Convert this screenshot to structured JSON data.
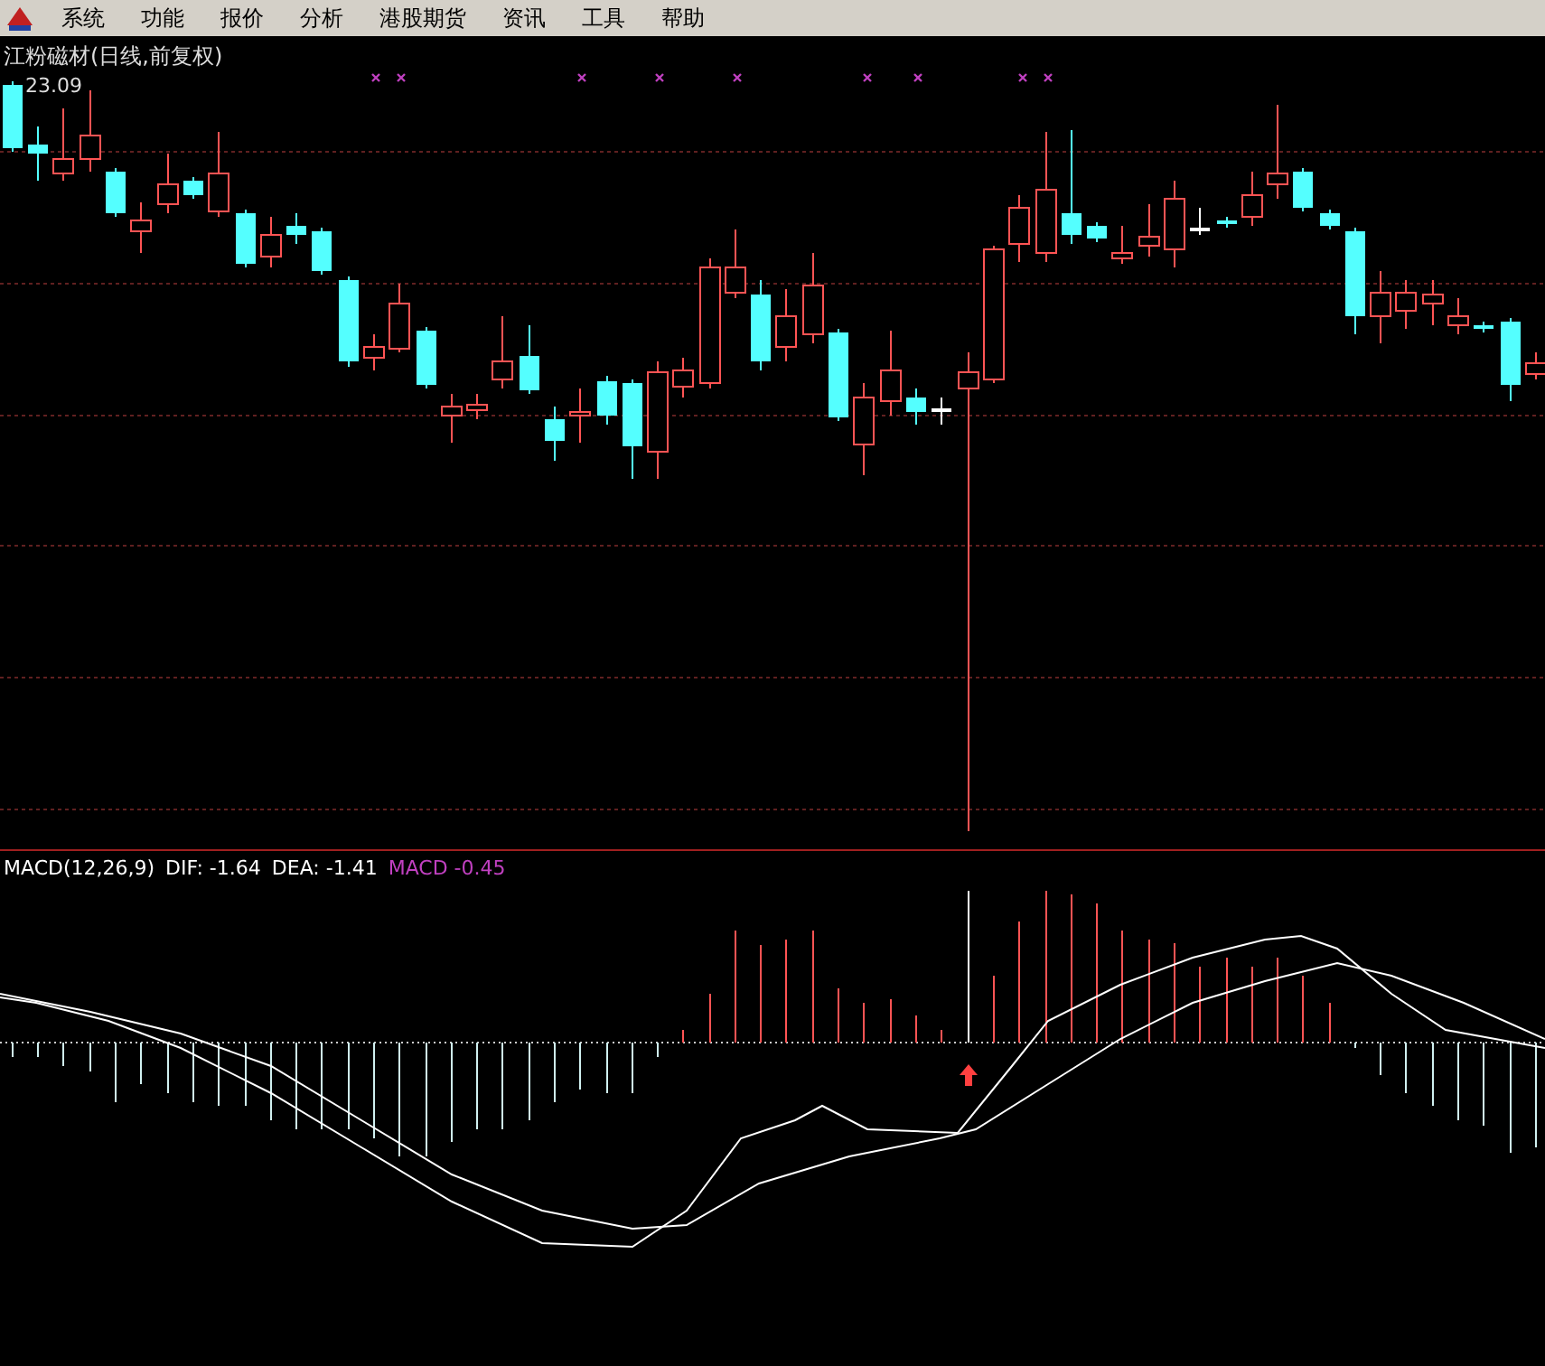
{
  "menu": [
    {
      "label": "系统"
    },
    {
      "label": "功能"
    },
    {
      "label": "报价"
    },
    {
      "label": "分析"
    },
    {
      "label": "港股期货"
    },
    {
      "label": "资讯"
    },
    {
      "label": "工具"
    },
    {
      "label": "帮助"
    }
  ],
  "price_chart": {
    "title": "江粉磁材(日线,前复权)",
    "high_label": "23.09"
  },
  "macd_legend": [
    {
      "text": "MACD(12,26,9)",
      "color": "#ffffff"
    },
    {
      "text": "DIF: -1.64",
      "color": "#ffffff"
    },
    {
      "text": "DEA: -1.41",
      "color": "#ffffff"
    },
    {
      "text": "MACD -0.45",
      "color": "#c040c0"
    }
  ]
}
